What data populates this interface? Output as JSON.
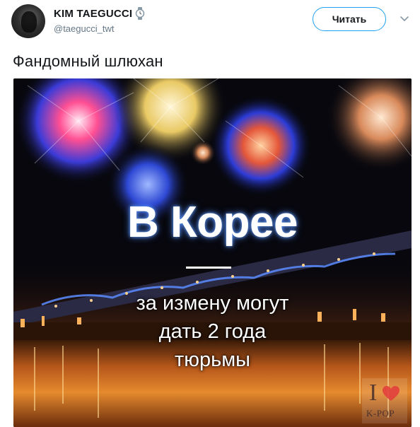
{
  "tweet": {
    "author": {
      "display_name": "KIM TAEGUCCI",
      "handle": "@taegucci_twt",
      "badge_icon": "watch-icon"
    },
    "follow_label": "Читать",
    "menu_icon": "chevron-down-icon",
    "text": "Фандомный шлюхан"
  },
  "media": {
    "headline": "В Корее",
    "body_lines": [
      "за измену могут",
      "дать 2 года",
      "тюрьмы"
    ],
    "watermark": {
      "letter": "I",
      "brand": "K-POP"
    }
  },
  "colors": {
    "accent": "#1da1f2",
    "text_primary": "#14171a",
    "text_secondary": "#657786"
  }
}
